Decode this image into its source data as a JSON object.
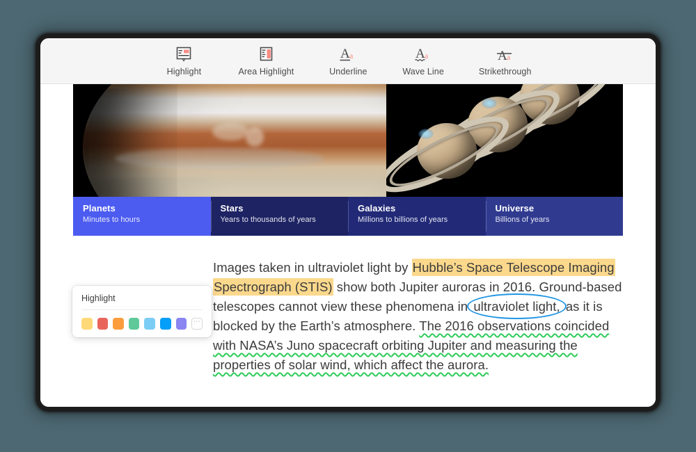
{
  "app": {
    "background_color": "#4d6872",
    "window_background": "#ffffff"
  },
  "toolbar": {
    "tools": [
      {
        "label": "Highlight",
        "icon": "highlight-icon"
      },
      {
        "label": "Area Highlight",
        "icon": "area-highlight-icon"
      },
      {
        "label": "Underline",
        "icon": "underline-icon"
      },
      {
        "label": "Wave Line",
        "icon": "wave-line-icon"
      },
      {
        "label": "Strikethrough",
        "icon": "strikethrough-icon"
      }
    ],
    "icon_accent_color": "#f98d85",
    "icon_outline_color": "#4b4b4b"
  },
  "document": {
    "figure": {
      "alt": "Jupiter close-up beside three ringed Saturn images with auroras",
      "banner_segments": [
        {
          "title": "Planets",
          "subtitle": "Minutes to hours",
          "color": "#4c5cf0"
        },
        {
          "title": "Stars",
          "subtitle": "Years to thousands of years",
          "color": "rgba(47,57,160,0.62)"
        },
        {
          "title": "Galaxies",
          "subtitle": "Millions to billions of years",
          "color": "rgba(42,52,150,0.80)"
        },
        {
          "title": "Universe",
          "subtitle": "Billions of years",
          "color": "#303b90"
        }
      ]
    },
    "paragraph": {
      "seg1": "Images taken in ultraviolet light by ",
      "highlight1": "Hubble’s Space Telescope Imaging Spectrograph (STIS)",
      "seg2": " show both Jupiter auroras in 2016. Ground-based telescopes cannot view these phenomena in ",
      "circled": "ultraviolet light,",
      "seg3": " as it is blocked by  the Earth’s atmosphere. ",
      "wavy": "The 2016 observations coincided with NASA’s Juno  spacecraft orbiting Jupiter and measuring the properties of solar wind, which affect the aurora.",
      "highlight_color": "#fbd88c",
      "circle_color": "#2196e3",
      "wave_color": "#2ecc5a"
    }
  },
  "highlight_popup": {
    "title": "Highlight",
    "more_label": "⋯",
    "swatches": [
      {
        "name": "yellow",
        "color": "#ffd878"
      },
      {
        "name": "red",
        "color": "#e9655b"
      },
      {
        "name": "orange",
        "color": "#fb9d3c"
      },
      {
        "name": "green",
        "color": "#5fc99a"
      },
      {
        "name": "sky",
        "color": "#7ccdf5"
      },
      {
        "name": "blue",
        "color": "#059ef8"
      },
      {
        "name": "purple",
        "color": "#8a85f0"
      }
    ]
  }
}
